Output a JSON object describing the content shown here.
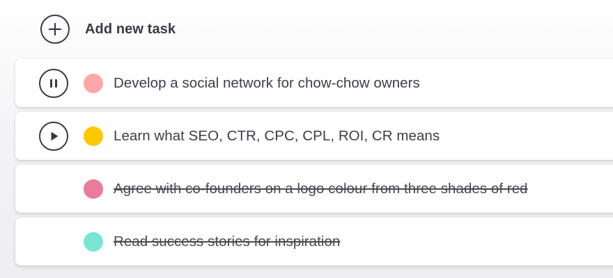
{
  "add_task": {
    "label": "Add new task",
    "icon": "plus-icon"
  },
  "tasks": [
    {
      "text": "Develop a social network for chow-chow owners",
      "color": "#fda7a7",
      "control": "pause-icon",
      "completed": false
    },
    {
      "text": "Learn what SEO, CTR, CPC, CPL, ROI, CR means",
      "color": "#fec800",
      "control": "play-icon",
      "completed": false
    },
    {
      "text": "Agree with co-founders on a logo colour from three shades of red",
      "color": "#ec7a9b",
      "control": null,
      "completed": true
    },
    {
      "text": "Read success stories for inspiration",
      "color": "#77e7d3",
      "control": null,
      "completed": true
    }
  ],
  "colors": {
    "text": "#3f3c49",
    "icon_stroke": "#3a3745",
    "card_background": "#ffffff"
  }
}
